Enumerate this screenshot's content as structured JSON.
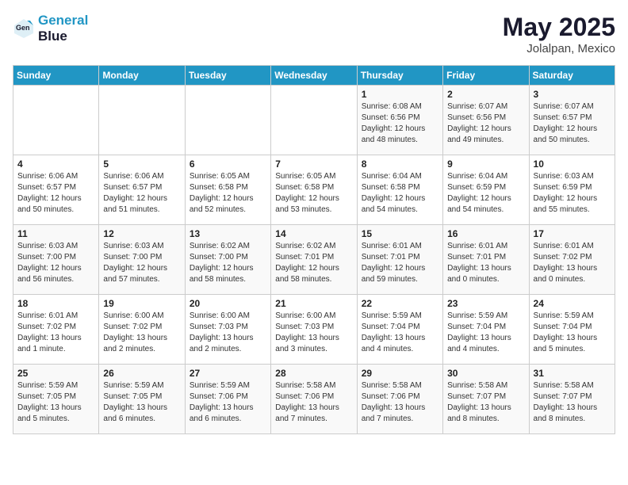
{
  "header": {
    "logo_line1": "General",
    "logo_line2": "Blue",
    "title": "May 2025",
    "subtitle": "Jolalpan, Mexico"
  },
  "weekdays": [
    "Sunday",
    "Monday",
    "Tuesday",
    "Wednesday",
    "Thursday",
    "Friday",
    "Saturday"
  ],
  "weeks": [
    [
      {
        "day": "",
        "info": ""
      },
      {
        "day": "",
        "info": ""
      },
      {
        "day": "",
        "info": ""
      },
      {
        "day": "",
        "info": ""
      },
      {
        "day": "1",
        "info": "Sunrise: 6:08 AM\nSunset: 6:56 PM\nDaylight: 12 hours\nand 48 minutes."
      },
      {
        "day": "2",
        "info": "Sunrise: 6:07 AM\nSunset: 6:56 PM\nDaylight: 12 hours\nand 49 minutes."
      },
      {
        "day": "3",
        "info": "Sunrise: 6:07 AM\nSunset: 6:57 PM\nDaylight: 12 hours\nand 50 minutes."
      }
    ],
    [
      {
        "day": "4",
        "info": "Sunrise: 6:06 AM\nSunset: 6:57 PM\nDaylight: 12 hours\nand 50 minutes."
      },
      {
        "day": "5",
        "info": "Sunrise: 6:06 AM\nSunset: 6:57 PM\nDaylight: 12 hours\nand 51 minutes."
      },
      {
        "day": "6",
        "info": "Sunrise: 6:05 AM\nSunset: 6:58 PM\nDaylight: 12 hours\nand 52 minutes."
      },
      {
        "day": "7",
        "info": "Sunrise: 6:05 AM\nSunset: 6:58 PM\nDaylight: 12 hours\nand 53 minutes."
      },
      {
        "day": "8",
        "info": "Sunrise: 6:04 AM\nSunset: 6:58 PM\nDaylight: 12 hours\nand 54 minutes."
      },
      {
        "day": "9",
        "info": "Sunrise: 6:04 AM\nSunset: 6:59 PM\nDaylight: 12 hours\nand 54 minutes."
      },
      {
        "day": "10",
        "info": "Sunrise: 6:03 AM\nSunset: 6:59 PM\nDaylight: 12 hours\nand 55 minutes."
      }
    ],
    [
      {
        "day": "11",
        "info": "Sunrise: 6:03 AM\nSunset: 7:00 PM\nDaylight: 12 hours\nand 56 minutes."
      },
      {
        "day": "12",
        "info": "Sunrise: 6:03 AM\nSunset: 7:00 PM\nDaylight: 12 hours\nand 57 minutes."
      },
      {
        "day": "13",
        "info": "Sunrise: 6:02 AM\nSunset: 7:00 PM\nDaylight: 12 hours\nand 58 minutes."
      },
      {
        "day": "14",
        "info": "Sunrise: 6:02 AM\nSunset: 7:01 PM\nDaylight: 12 hours\nand 58 minutes."
      },
      {
        "day": "15",
        "info": "Sunrise: 6:01 AM\nSunset: 7:01 PM\nDaylight: 12 hours\nand 59 minutes."
      },
      {
        "day": "16",
        "info": "Sunrise: 6:01 AM\nSunset: 7:01 PM\nDaylight: 13 hours\nand 0 minutes."
      },
      {
        "day": "17",
        "info": "Sunrise: 6:01 AM\nSunset: 7:02 PM\nDaylight: 13 hours\nand 0 minutes."
      }
    ],
    [
      {
        "day": "18",
        "info": "Sunrise: 6:01 AM\nSunset: 7:02 PM\nDaylight: 13 hours\nand 1 minute."
      },
      {
        "day": "19",
        "info": "Sunrise: 6:00 AM\nSunset: 7:02 PM\nDaylight: 13 hours\nand 2 minutes."
      },
      {
        "day": "20",
        "info": "Sunrise: 6:00 AM\nSunset: 7:03 PM\nDaylight: 13 hours\nand 2 minutes."
      },
      {
        "day": "21",
        "info": "Sunrise: 6:00 AM\nSunset: 7:03 PM\nDaylight: 13 hours\nand 3 minutes."
      },
      {
        "day": "22",
        "info": "Sunrise: 5:59 AM\nSunset: 7:04 PM\nDaylight: 13 hours\nand 4 minutes."
      },
      {
        "day": "23",
        "info": "Sunrise: 5:59 AM\nSunset: 7:04 PM\nDaylight: 13 hours\nand 4 minutes."
      },
      {
        "day": "24",
        "info": "Sunrise: 5:59 AM\nSunset: 7:04 PM\nDaylight: 13 hours\nand 5 minutes."
      }
    ],
    [
      {
        "day": "25",
        "info": "Sunrise: 5:59 AM\nSunset: 7:05 PM\nDaylight: 13 hours\nand 5 minutes."
      },
      {
        "day": "26",
        "info": "Sunrise: 5:59 AM\nSunset: 7:05 PM\nDaylight: 13 hours\nand 6 minutes."
      },
      {
        "day": "27",
        "info": "Sunrise: 5:59 AM\nSunset: 7:06 PM\nDaylight: 13 hours\nand 6 minutes."
      },
      {
        "day": "28",
        "info": "Sunrise: 5:58 AM\nSunset: 7:06 PM\nDaylight: 13 hours\nand 7 minutes."
      },
      {
        "day": "29",
        "info": "Sunrise: 5:58 AM\nSunset: 7:06 PM\nDaylight: 13 hours\nand 7 minutes."
      },
      {
        "day": "30",
        "info": "Sunrise: 5:58 AM\nSunset: 7:07 PM\nDaylight: 13 hours\nand 8 minutes."
      },
      {
        "day": "31",
        "info": "Sunrise: 5:58 AM\nSunset: 7:07 PM\nDaylight: 13 hours\nand 8 minutes."
      }
    ]
  ]
}
